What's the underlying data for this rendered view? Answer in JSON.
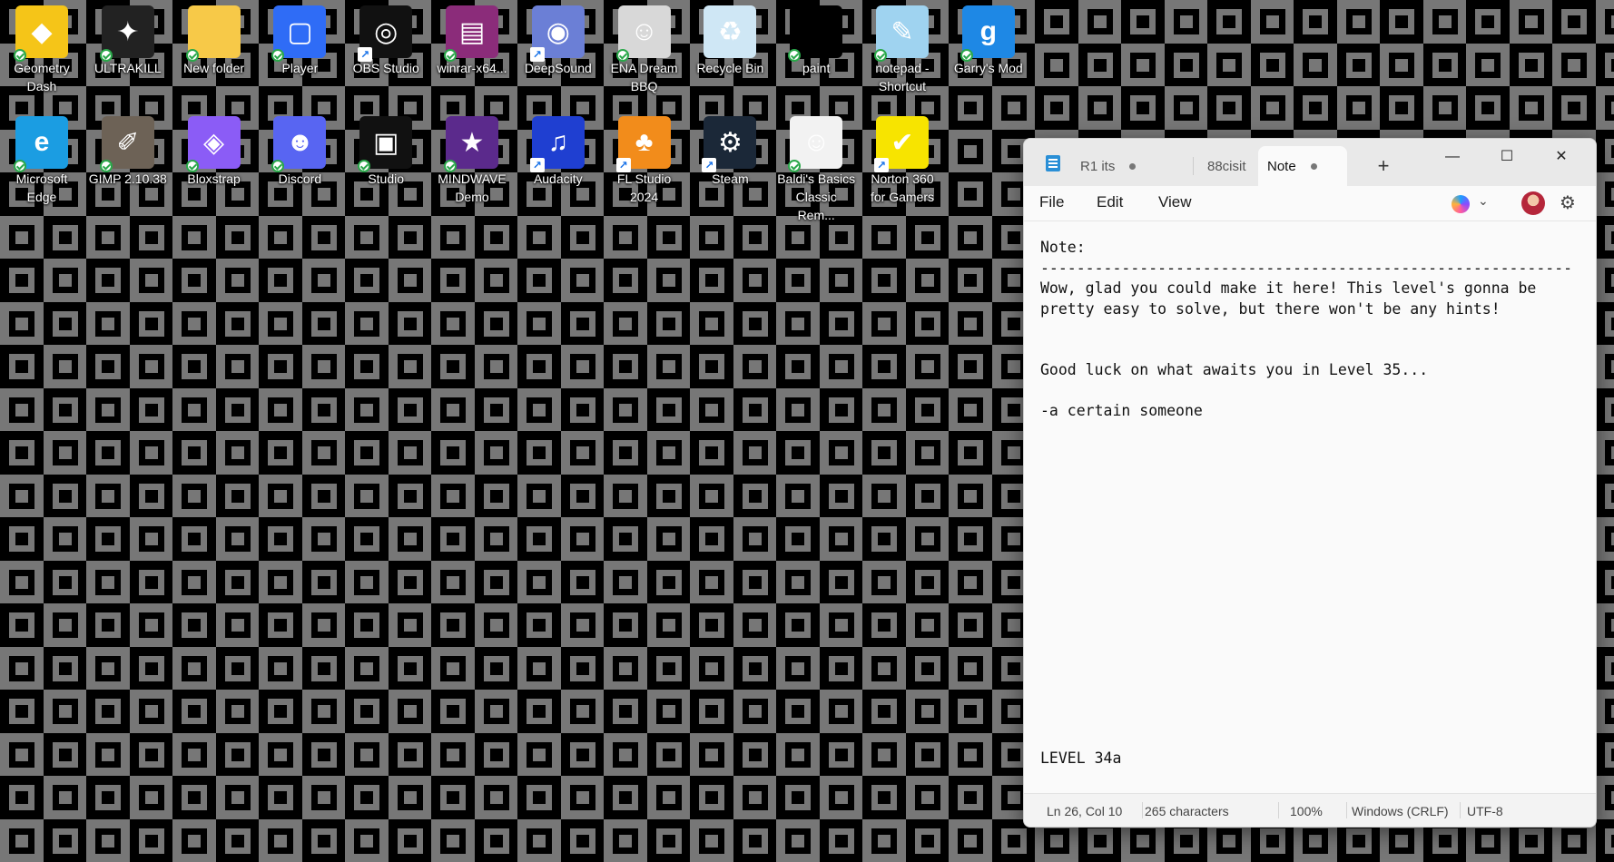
{
  "desktop": {
    "icons": [
      {
        "label": "Geometry\nDash",
        "icon": "geometry-dash-icon",
        "color": "#f5c518",
        "glyph": "◆",
        "badge": "check"
      },
      {
        "label": "ULTRAKILL",
        "icon": "ultrakill-icon",
        "color": "#222222",
        "glyph": "✦",
        "badge": "check"
      },
      {
        "label": "New folder",
        "icon": "folder-icon",
        "color": "#f7c948",
        "glyph": "",
        "badge": "check"
      },
      {
        "label": "Player",
        "icon": "roblox-player-icon",
        "color": "#2f6cf6",
        "glyph": "▢",
        "badge": "check"
      },
      {
        "label": "OBS Studio",
        "icon": "obs-studio-icon",
        "color": "#111111",
        "glyph": "◎",
        "badge": "arrow"
      },
      {
        "label": "winrar-x64...",
        "icon": "winrar-icon",
        "color": "#8b2c7a",
        "glyph": "▤",
        "badge": "check"
      },
      {
        "label": "DeepSound",
        "icon": "deepsound-icon",
        "color": "#6b7fd6",
        "glyph": "◉",
        "badge": "arrow"
      },
      {
        "label": "ENA Dream\nBBQ",
        "icon": "ena-dream-bbq-icon",
        "color": "#d8d8d8",
        "glyph": "☺",
        "badge": "check"
      },
      {
        "label": "Recycle Bin",
        "icon": "recycle-bin-icon",
        "color": "#cfe7f5",
        "glyph": "♻",
        "badge": "none"
      },
      {
        "label": "paint",
        "icon": "paint-icon",
        "color": "#000000",
        "glyph": "",
        "badge": "check"
      },
      {
        "label": "notepad -\nShortcut",
        "icon": "notepad-shortcut-icon",
        "color": "#9fd3f0",
        "glyph": "✎",
        "badge": "check"
      },
      {
        "label": "Garry's Mod",
        "icon": "garrys-mod-icon",
        "color": "#1e88e5",
        "glyph": "g",
        "badge": "check"
      },
      {
        "label": "Microsoft\nEdge",
        "icon": "microsoft-edge-icon",
        "color": "#1b9de2",
        "glyph": "e",
        "badge": "check"
      },
      {
        "label": "GIMP 2.10.38",
        "icon": "gimp-icon",
        "color": "#6d6256",
        "glyph": "✐",
        "badge": "check"
      },
      {
        "label": "Bloxstrap",
        "icon": "bloxstrap-icon",
        "color": "#8b5cf6",
        "glyph": "◈",
        "badge": "check"
      },
      {
        "label": "Discord",
        "icon": "discord-icon",
        "color": "#5865f2",
        "glyph": "☻",
        "badge": "check"
      },
      {
        "label": "Studio",
        "icon": "roblox-studio-icon",
        "color": "#111111",
        "glyph": "▣",
        "badge": "check"
      },
      {
        "label": "MINDWAVE\nDemo",
        "icon": "mindwave-demo-icon",
        "color": "#5b2a8c",
        "glyph": "★",
        "badge": "check"
      },
      {
        "label": "Audacity",
        "icon": "audacity-icon",
        "color": "#1f3fd1",
        "glyph": "♫",
        "badge": "arrow"
      },
      {
        "label": "FL Studio\n2024",
        "icon": "fl-studio-icon",
        "color": "#f28c1b",
        "glyph": "♣",
        "badge": "arrow"
      },
      {
        "label": "Steam",
        "icon": "steam-icon",
        "color": "#1b2838",
        "glyph": "⚙",
        "badge": "arrow"
      },
      {
        "label": "Baldi's Basics\nClassic Rem...",
        "icon": "baldis-basics-icon",
        "color": "#f2f2f2",
        "glyph": "☺",
        "badge": "check"
      },
      {
        "label": "Norton 360\nfor Gamers",
        "icon": "norton-360-icon",
        "color": "#f7e400",
        "glyph": "✔",
        "badge": "arrow"
      }
    ]
  },
  "notepad": {
    "tabs": [
      {
        "label": "R1 its"
      },
      {
        "label": "88cisit"
      },
      {
        "label": "Note"
      }
    ],
    "new_tab": "+",
    "window": {
      "minimize": "—",
      "maximize": "☐",
      "close": "✕"
    },
    "menu": {
      "file": "File",
      "edit": "Edit",
      "view": "View"
    },
    "content": "Note:\n-----------------------------------------------------------\nWow, glad you could make it here! This level's gonna be\npretty easy to solve, but there won't be any hints!\n\n\nGood luck on what awaits you in Level 35...\n\n-a certain someone\n\n\n\n\n\n\n\n\n\n\n\n\n\n\n\n\nLEVEL 34a",
    "status": {
      "position": "Ln 26, Col 10",
      "characters": "265 characters",
      "zoom": "100%",
      "line_ending": "Windows (CRLF)",
      "encoding": "UTF-8"
    }
  }
}
